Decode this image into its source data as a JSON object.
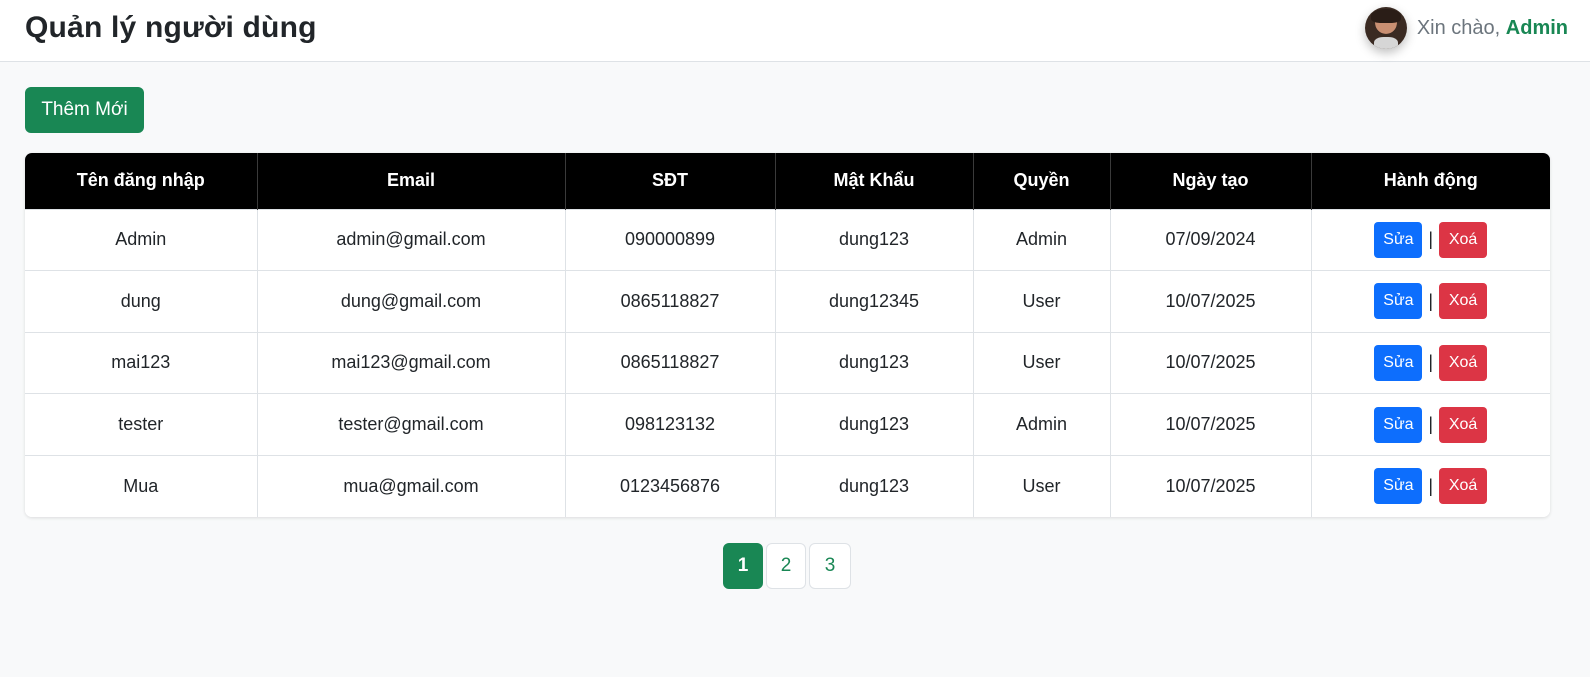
{
  "header": {
    "title": "Quản lý người dùng",
    "greeting_prefix": "Xin chào,",
    "username": "Admin"
  },
  "toolbar": {
    "add_label": "Thêm Mới"
  },
  "table": {
    "columns": [
      "Tên đăng nhập",
      "Email",
      "SĐT",
      "Mật Khẩu",
      "Quyền",
      "Ngày tạo",
      "Hành động"
    ],
    "rows": [
      [
        "Admin",
        "admin@gmail.com",
        "090000899",
        "dung123",
        "Admin",
        "07/09/2024"
      ],
      [
        "dung",
        "dung@gmail.com",
        "0865118827",
        "dung12345",
        "User",
        "10/07/2025"
      ],
      [
        "mai123",
        "mai123@gmail.com",
        "0865118827",
        "dung123",
        "User",
        "10/07/2025"
      ],
      [
        "tester",
        "tester@gmail.com",
        "098123132",
        "dung123",
        "Admin",
        "10/07/2025"
      ],
      [
        "Mua",
        "mua@gmail.com",
        "0123456876",
        "dung123",
        "User",
        "10/07/2025"
      ]
    ],
    "edit_label": "Sửa",
    "separator": "|",
    "delete_label": "Xoá"
  },
  "pagination": {
    "pages": [
      "1",
      "2",
      "3"
    ],
    "active": "1"
  },
  "colors": {
    "primary": "#198754",
    "edit": "#0d6efd",
    "delete": "#dc3545",
    "table_header": "#000000"
  }
}
